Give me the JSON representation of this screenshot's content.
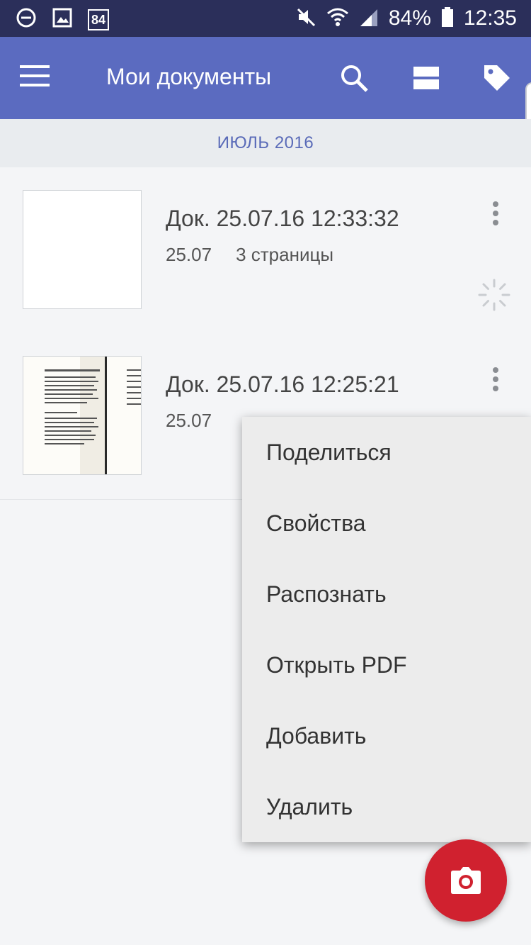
{
  "status_bar": {
    "battery": "84%",
    "time": "12:35",
    "calendar_day": "84",
    "icons": [
      "do-not-disturb-icon",
      "image-icon",
      "calendar-icon",
      "mute-icon",
      "wifi-icon",
      "signal-icon",
      "battery-icon"
    ]
  },
  "toolbar": {
    "title": "Мои документы",
    "icons": [
      "menu-icon",
      "search-icon",
      "view-toggle-icon",
      "tag-icon"
    ]
  },
  "month_header": "ИЮЛЬ 2016",
  "documents": [
    {
      "title": "Док. 25.07.16 12:33:32",
      "date": "25.07",
      "pages": "3 страницы",
      "status_icon": "loading-spinner-icon"
    },
    {
      "title": "Док. 25.07.16 12:25:21",
      "date": "25.07",
      "pages": ""
    }
  ],
  "popup_menu": {
    "items": [
      "Поделиться",
      "Свойства",
      "Распознать",
      "Открыть PDF",
      "Добавить",
      "Удалить"
    ]
  },
  "fab": {
    "icon": "camera-icon"
  },
  "colors": {
    "status_bar": "#2b2f5a",
    "toolbar": "#5b6bc0",
    "month_text": "#5a6bb8",
    "fab": "#d0212f"
  }
}
